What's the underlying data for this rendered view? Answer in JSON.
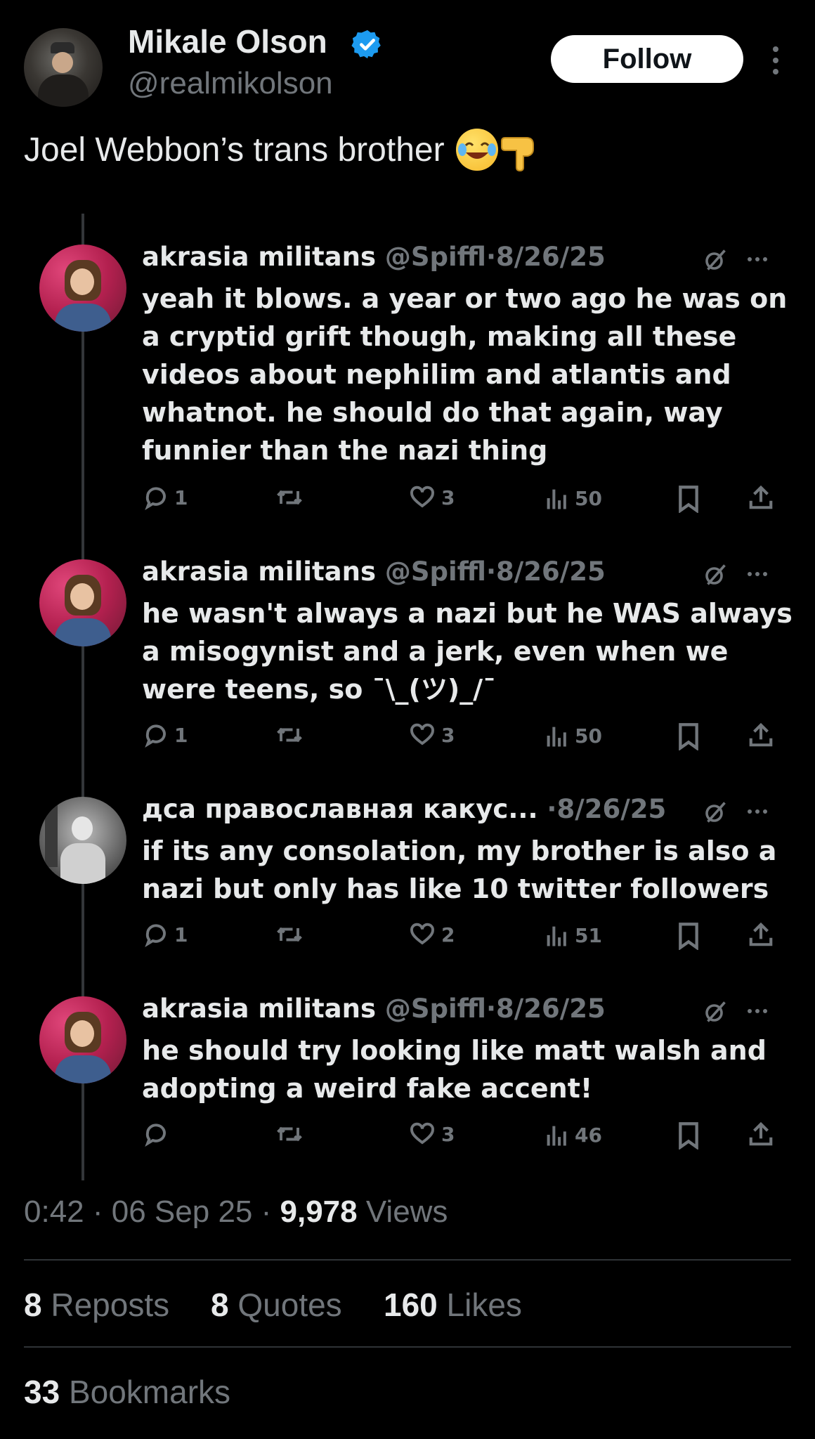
{
  "author": {
    "name": "Mikale Olson",
    "handle": "@realmikolson",
    "verified": true
  },
  "follow_label": "Follow",
  "post_text": "Joel Webbon’s trans brother",
  "post_emoji": [
    "face-with-tears-of-joy",
    "backhand-index-pointing-down"
  ],
  "replies": [
    {
      "name": "akrasia militans",
      "handle": "@Spiffl",
      "date": "8/26/25",
      "text": "yeah it blows. a year or two ago he was on a cryptid grift though, making all these videos about nephilim and atlantis and whatnot. he should do that again, way funnier than the nazi thing",
      "replies": "1",
      "reposts": "",
      "likes": "3",
      "views": "50"
    },
    {
      "name": "akrasia militans",
      "handle": "@Spiffl",
      "date": "8/26/25",
      "text": "he wasn't always a nazi but he WAS always a misogynist and a jerk, even when we were teens, so ¯\\_(ツ)_/¯",
      "replies": "1",
      "reposts": "",
      "likes": "3",
      "views": "50"
    },
    {
      "name": "дса православная какус...",
      "handle": "",
      "date": "8/26/25",
      "text": "if its any consolation, my brother is also a nazi but only has like 10 twitter followers",
      "replies": "1",
      "reposts": "",
      "likes": "2",
      "views": "51"
    },
    {
      "name": "akrasia militans",
      "handle": "@Spiffl",
      "date": "8/26/25",
      "text": "he should try looking like matt walsh and adopting a weird fake accent!",
      "replies": "",
      "reposts": "",
      "likes": "3",
      "views": "46"
    }
  ],
  "meta": {
    "time": "0:42",
    "date": "06 Sep 25",
    "views_count": "9,978",
    "views_label": "Views"
  },
  "stats": {
    "reposts_count": "8",
    "reposts_label": "Reposts",
    "quotes_count": "8",
    "quotes_label": "Quotes",
    "likes_count": "160",
    "likes_label": "Likes",
    "bookmarks_count": "33",
    "bookmarks_label": "Bookmarks"
  },
  "separator": "·",
  "colors": {
    "background": "#000000",
    "text": "#e7e9ea",
    "muted": "#71767b",
    "verified": "#1d9bf0",
    "divider": "#2f3336"
  }
}
